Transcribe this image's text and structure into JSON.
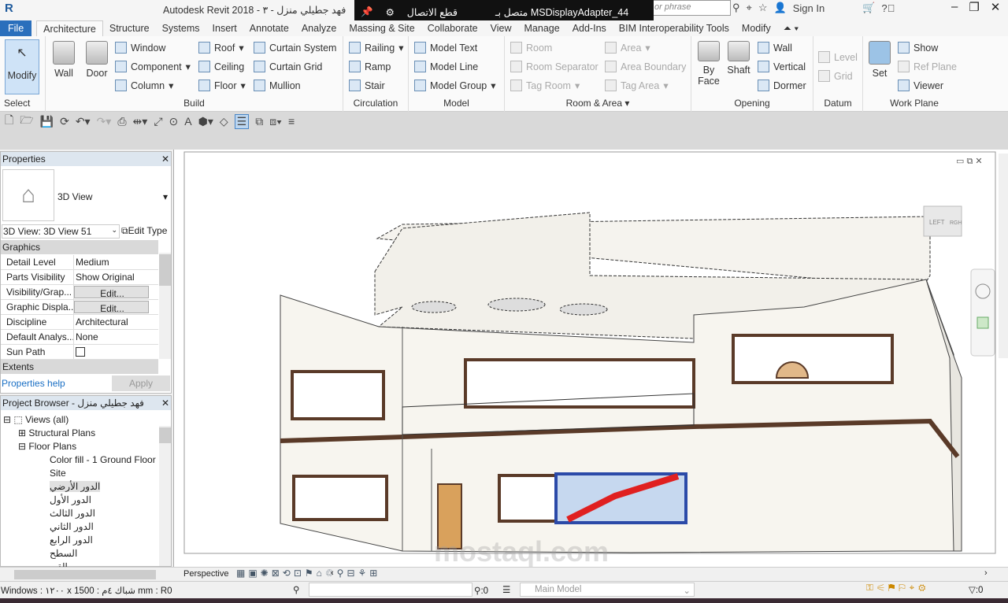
{
  "titlebar": {
    "app_title": "Autodesk Revit 2018 -  فهد جطيلي منزل - ٣",
    "search_placeholder": "or phrase",
    "sign_in": "Sign In",
    "remote": {
      "disconnect": "قطع الاتصال",
      "connected": "متصل بـ MSDisplayAdapter_44"
    }
  },
  "tabs": [
    "File",
    "Architecture",
    "Structure",
    "Systems",
    "Insert",
    "Annotate",
    "Analyze",
    "Massing & Site",
    "Collaborate",
    "View",
    "Manage",
    "Add-Ins",
    "BIM Interoperability Tools",
    "Modify"
  ],
  "active_tab": "Architecture",
  "ribbon": {
    "select": {
      "modify": "Modify",
      "label": "Select"
    },
    "build": {
      "label": "Build",
      "wall": "Wall",
      "door": "Door",
      "window": "Window",
      "component": "Component",
      "column": "Column",
      "roof": "Roof",
      "ceiling": "Ceiling",
      "floor": "Floor",
      "curtain_system": "Curtain  System",
      "curtain_grid": "Curtain  Grid",
      "mullion": "Mullion"
    },
    "circulation": {
      "label": "Circulation",
      "railing": "Railing",
      "ramp": "Ramp",
      "stair": "Stair"
    },
    "model": {
      "label": "Model",
      "text": "Model  Text",
      "line": "Model  Line",
      "group": "Model  Group"
    },
    "room_area": {
      "label": "Room & Area",
      "room": "Room",
      "room_separator": "Room  Separator",
      "tag_room": "Tag  Room",
      "area": "Area",
      "area_boundary": "Area  Boundary",
      "tag_area": "Tag  Area"
    },
    "opening": {
      "label": "Opening",
      "by_face": "By Face",
      "shaft": "Shaft",
      "wall": "Wall",
      "vertical": "Vertical",
      "dormer": "Dormer"
    },
    "datum": {
      "label": "Datum",
      "level": "Level",
      "grid": "Grid"
    },
    "work_plane": {
      "label": "Work Plane",
      "set": "Set",
      "show": "Show",
      "ref_plane": "Ref  Plane",
      "viewer": "Viewer"
    }
  },
  "properties": {
    "title": "Properties",
    "type_name": "3D View",
    "instance": "3D View: 3D View 51",
    "edit_type": "Edit Type",
    "groups": [
      "Graphics",
      "Extents"
    ],
    "rows": [
      {
        "k": "Detail Level",
        "v": "Medium"
      },
      {
        "k": "Parts Visibility",
        "v": "Show Original"
      },
      {
        "k": "Visibility/Grap...",
        "v": "Edit..."
      },
      {
        "k": "Graphic Displa...",
        "v": "Edit..."
      },
      {
        "k": "Discipline",
        "v": "Architectural"
      },
      {
        "k": "Default Analys...",
        "v": "None"
      },
      {
        "k": "Sun Path",
        "v": ""
      }
    ],
    "sun_path_checked": false,
    "help": "Properties help",
    "apply": "Apply"
  },
  "project_browser": {
    "title": "Project Browser - فهد جطيلي منزل",
    "views": "Views (all)",
    "structural_plans": "Structural Plans",
    "floor_plans": "Floor Plans",
    "items": [
      "Color fill - 1 Ground Floor",
      "Site",
      "الدور الأرضي",
      "الدور الأول",
      "الدور الثالث",
      "الدور الثاني",
      "الدور الرابع",
      "السطح",
      "القبو"
    ],
    "selected": "الدور الأرضي"
  },
  "viewcube": {
    "left": "LEFT",
    "right": "RGH"
  },
  "view_control_bar": {
    "mode": "Perspective"
  },
  "status_bar": {
    "message": "Windows : ١٢٠٠ x شباك ٤م : 1500 mm : R0",
    "workset_zero": ":0",
    "design_option": "Main Model",
    "filter_count": ":0"
  },
  "watermark": "mostaql.com"
}
